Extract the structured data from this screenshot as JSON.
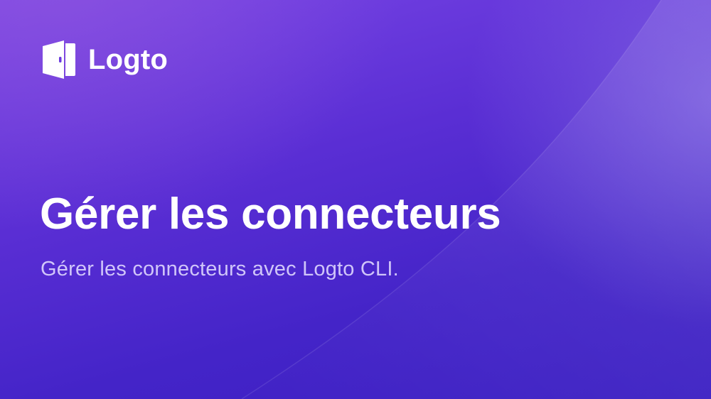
{
  "brand": {
    "name": "Logto",
    "logo_icon": "door-logo-icon"
  },
  "hero": {
    "title": "Gérer les connecteurs",
    "subtitle": "Gérer les connecteurs avec Logto CLI."
  },
  "colors": {
    "background_top": "#7a46e6",
    "background_bottom": "#3a1ec2",
    "text_primary": "#ffffff",
    "text_secondary": "#e2dcff"
  }
}
